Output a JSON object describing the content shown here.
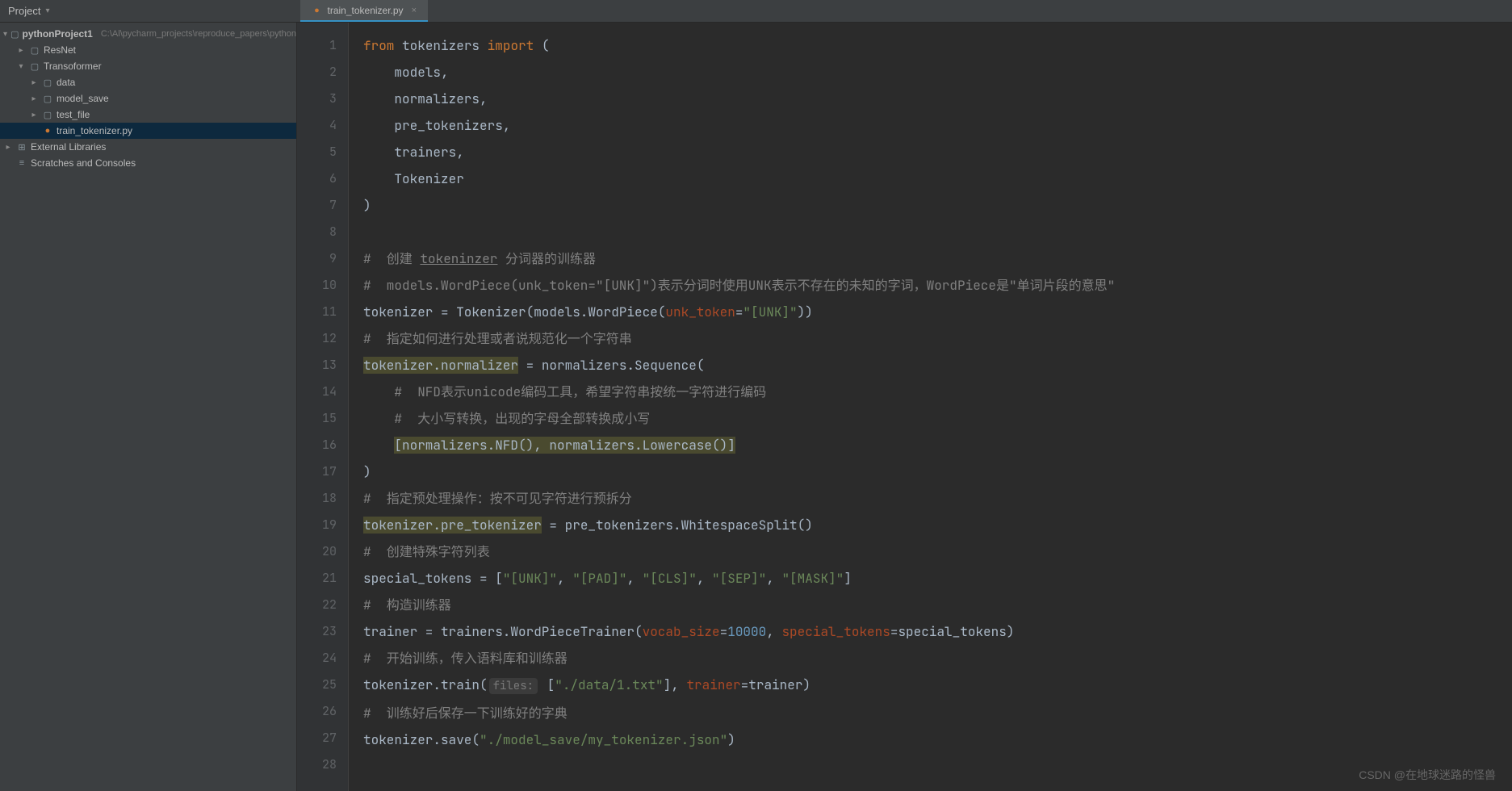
{
  "toolbar": {
    "project_label": "Project"
  },
  "tab": {
    "filename": "train_tokenizer.py"
  },
  "tree": {
    "root": {
      "name": "pythonProject1",
      "path": "C:\\Al\\pycharm_projects\\reproduce_papers\\python"
    },
    "resnet": "ResNet",
    "transformer": "Transoformer",
    "data": "data",
    "model_save": "model_save",
    "test_file": "test_file",
    "train_tokenizer": "train_tokenizer.py",
    "external_libs": "External Libraries",
    "scratches": "Scratches and Consoles"
  },
  "gutter": {
    "lines": [
      "1",
      "2",
      "3",
      "4",
      "5",
      "6",
      "7",
      "8",
      "9",
      "10",
      "11",
      "12",
      "13",
      "14",
      "15",
      "16",
      "17",
      "18",
      "19",
      "20",
      "21",
      "22",
      "23",
      "24",
      "25",
      "26",
      "27",
      "28"
    ]
  },
  "code": {
    "l1_from": "from",
    "l1_mod": "tokenizers",
    "l1_import": "import",
    "l1_paren": "(",
    "l2": "    models,",
    "l3": "    normalizers,",
    "l4": "    pre_tokenizers,",
    "l5": "    trainers,",
    "l6": "    Tokenizer",
    "l7": ")",
    "l9": "#  创建 tokeninzer 分词器的训练器",
    "l9_word": "tokeninzer",
    "l9_pre": "#  创建 ",
    "l9_post": " 分词器的训练器",
    "l10": "#  models.WordPiece(unk_token=\"[UNK]\")表示分词时使用UNK表示不存在的未知的字词，WordPiece是\"单词片段的意思\"",
    "l11_a": "tokenizer = Tokenizer(models.WordPiece(",
    "l11_param": "unk_token",
    "l11_eq": "=",
    "l11_str": "\"[UNK]\"",
    "l11_end": "))",
    "l12": "#  指定如何进行处理或者说规范化一个字符串",
    "l13_hl": "tokenizer.normalizer",
    "l13_rest": " = normalizers.Sequence(",
    "l14": "    #  NFD表示unicode编码工具，希望字符串按统一字符进行编码",
    "l15": "    #  大小写转换，出现的字母全部转换成小写",
    "l16_pre": "    ",
    "l16_hl": "[normalizers.NFD(), normalizers.Lowercase()]",
    "l17": ")",
    "l18": "#  指定预处理操作：按不可见字符进行预拆分",
    "l19_hl": "tokenizer.pre_tokenizer",
    "l19_rest": " = pre_tokenizers.WhitespaceSplit()",
    "l20": "#  创建特殊字符列表",
    "l21_a": "special_tokens = [",
    "l21_s1": "\"[UNK]\"",
    "l21_c": ", ",
    "l21_s2": "\"[PAD]\"",
    "l21_s3": "\"[CLS]\"",
    "l21_s4": "\"[SEP]\"",
    "l21_s5": "\"[MASK]\"",
    "l21_end": "]",
    "l22": "#  构造训练器",
    "l23_a": "trainer = trainers.WordPieceTrainer(",
    "l23_p1": "vocab_size",
    "l23_eq": "=",
    "l23_num": "10000",
    "l23_c": ", ",
    "l23_p2": "special_tokens",
    "l23_v2": "=special_tokens)",
    "l24": "#  开始训练，传入语料库和训练器",
    "l25_a": "tokenizer.train(",
    "l25_hint": "files:",
    "l25_b": " [",
    "l25_str": "\"./data/1.txt\"",
    "l25_c": "], ",
    "l25_p": "trainer",
    "l25_end": "=trainer)",
    "l26": "#  训练好后保存一下训练好的字典",
    "l27_a": "tokenizer.save(",
    "l27_str": "\"./model_save/my_tokenizer.json\"",
    "l27_end": ")"
  },
  "watermark": "CSDN @在地球迷路的怪兽"
}
